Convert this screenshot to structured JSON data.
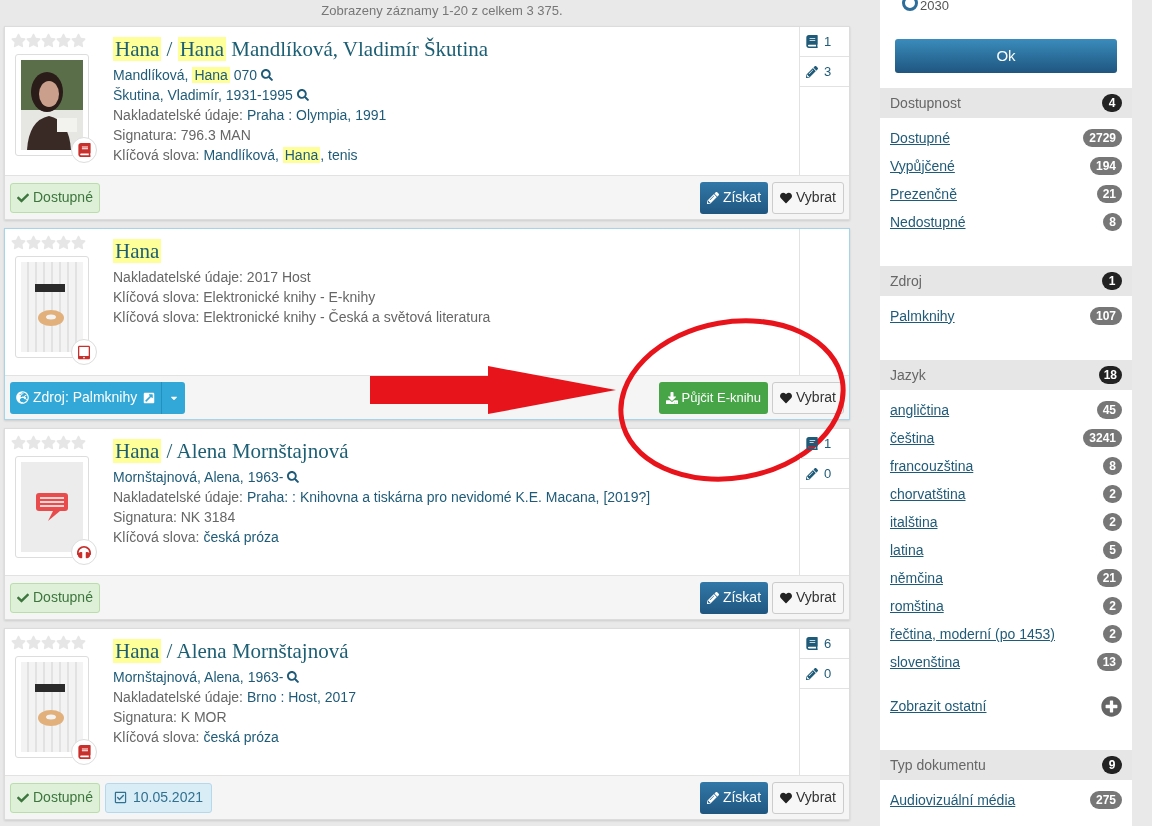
{
  "results_summary": "Zobrazeny záznamy 1-20 z celkem 3 375.",
  "records": [
    {
      "selected": false,
      "stars": 0,
      "cover": {
        "kind": "picture"
      },
      "format": {
        "kind": "book"
      },
      "title": [
        {
          "text": "Hana",
          "highlight": true
        },
        {
          "text": " / "
        },
        {
          "text": "Hana",
          "highlight": true
        },
        {
          "text": " Mandlíková, Vladimír Škutina"
        }
      ],
      "lines": [
        {
          "search": true,
          "segments": [
            {
              "text": "Mandlíková, "
            },
            {
              "text": "Hana",
              "highlight": true
            },
            {
              "text": " 070"
            }
          ]
        },
        {
          "search": true,
          "segments": [
            {
              "text": "Škutina, Vladimír, 1931-1995"
            }
          ]
        },
        {
          "label": "Nakladatelské údaje:",
          "segments": [
            {
              "text": "Praha : Olympia, 1991"
            }
          ]
        },
        {
          "label": "Signatura: 796.3 MAN"
        },
        {
          "label": "Klíčová slova:",
          "segments": [
            {
              "text": "Mandlíková, "
            },
            {
              "text": "Hana",
              "highlight": true
            },
            {
              "text": ", tenis"
            }
          ]
        }
      ],
      "counts": [
        {
          "kind": "copies",
          "value": "1"
        },
        {
          "kind": "reviews",
          "value": "3"
        }
      ],
      "left_actions": [
        {
          "kind": "status",
          "label": "Dostupné"
        }
      ],
      "right_actions": [
        {
          "kind": "get",
          "label": "Získat"
        },
        {
          "kind": "select",
          "label": "Vybrat"
        }
      ]
    },
    {
      "selected": true,
      "stars": 0,
      "cover": {
        "kind": "picture"
      },
      "format": {
        "kind": "tablet"
      },
      "title": [
        {
          "text": "Hana",
          "highlight": true
        }
      ],
      "lines": [
        {
          "label": "Nakladatelské údaje: 2017 Host"
        },
        {
          "label": "Klíčová slova: Elektronické knihy - E-knihy"
        },
        {
          "label": "Klíčová slova: Elektronické knihy - Česká a světová literatura"
        }
      ],
      "left_actions": [
        {
          "kind": "source",
          "label": "Zdroj: Palmknihy"
        }
      ],
      "right_actions": [
        {
          "kind": "borrow",
          "label": "Půjčit E-knihu"
        },
        {
          "kind": "select",
          "label": "Vybrat"
        }
      ]
    },
    {
      "selected": false,
      "stars": 0,
      "cover": {
        "kind": "placeholder"
      },
      "format": {
        "kind": "audio"
      },
      "title": [
        {
          "text": "Hana",
          "highlight": true
        },
        {
          "text": " / Alena Mornštajnová"
        }
      ],
      "lines": [
        {
          "search": true,
          "segments": [
            {
              "text": "Mornštajnová, Alena, 1963-"
            }
          ]
        },
        {
          "label": "Nakladatelské údaje:",
          "segments": [
            {
              "text": "Praha: : Knihovna a tiskárna pro nevidomé K.E. Macana, [2019?]"
            }
          ]
        },
        {
          "label": "Signatura: NK 3184"
        },
        {
          "label": "Klíčová slova:",
          "segments": [
            {
              "text": "česká próza"
            }
          ]
        }
      ],
      "counts": [
        {
          "kind": "copies",
          "value": "1"
        },
        {
          "kind": "reviews",
          "value": "0"
        }
      ],
      "left_actions": [
        {
          "kind": "status",
          "label": "Dostupné"
        }
      ],
      "right_actions": [
        {
          "kind": "get",
          "label": "Získat"
        },
        {
          "kind": "select",
          "label": "Vybrat"
        }
      ]
    },
    {
      "selected": false,
      "stars": 0,
      "cover": {
        "kind": "picture"
      },
      "format": {
        "kind": "book"
      },
      "title": [
        {
          "text": "Hana",
          "highlight": true
        },
        {
          "text": " / Alena Mornštajnová"
        }
      ],
      "lines": [
        {
          "search": true,
          "segments": [
            {
              "text": "Mornštajnová, Alena, 1963-"
            }
          ]
        },
        {
          "label": "Nakladatelské údaje:",
          "segments": [
            {
              "text": "Brno : Host, 2017"
            }
          ]
        },
        {
          "label": "Signatura: K MOR"
        },
        {
          "label": "Klíčová slova:",
          "segments": [
            {
              "text": "česká próza"
            }
          ]
        }
      ],
      "counts": [
        {
          "kind": "copies",
          "value": "6"
        },
        {
          "kind": "reviews",
          "value": "0"
        }
      ],
      "left_actions": [
        {
          "kind": "status",
          "label": "Dostupné"
        },
        {
          "kind": "date",
          "label": "10.05.2021"
        }
      ],
      "right_actions": [
        {
          "kind": "get",
          "label": "Získat"
        },
        {
          "kind": "select",
          "label": "Vybrat"
        }
      ]
    }
  ],
  "sidebar": {
    "year_option": {
      "label": "2030",
      "selected": false
    },
    "ok_button": "Ok",
    "facets": [
      {
        "title": "Dostupnost",
        "count": "4",
        "items": [
          {
            "label": "Dostupné",
            "count": "2729"
          },
          {
            "label": "Vypůjčené",
            "count": "194"
          },
          {
            "label": "Prezenčně",
            "count": "21"
          },
          {
            "label": "Nedostupné",
            "count": "8"
          }
        ]
      },
      {
        "title": "Zdroj",
        "count": "1",
        "items": [
          {
            "label": "Palmknihy",
            "count": "107"
          }
        ]
      },
      {
        "title": "Jazyk",
        "count": "18",
        "items": [
          {
            "label": "angličtina",
            "count": "45"
          },
          {
            "label": "čeština",
            "count": "3241"
          },
          {
            "label": "francouzština",
            "count": "8"
          },
          {
            "label": "chorvatština",
            "count": "2"
          },
          {
            "label": "italština",
            "count": "2"
          },
          {
            "label": "latina",
            "count": "5"
          },
          {
            "label": "němčina",
            "count": "21"
          },
          {
            "label": "romština",
            "count": "2"
          },
          {
            "label": "řečtina, moderní (po 1453)",
            "count": "2"
          },
          {
            "label": "slovenština",
            "count": "13"
          }
        ],
        "more": "Zobrazit ostatní"
      },
      {
        "title": "Typ dokumentu",
        "count": "9",
        "items": [
          {
            "label": "Audiovizuální média",
            "count": "275"
          }
        ]
      }
    ]
  }
}
